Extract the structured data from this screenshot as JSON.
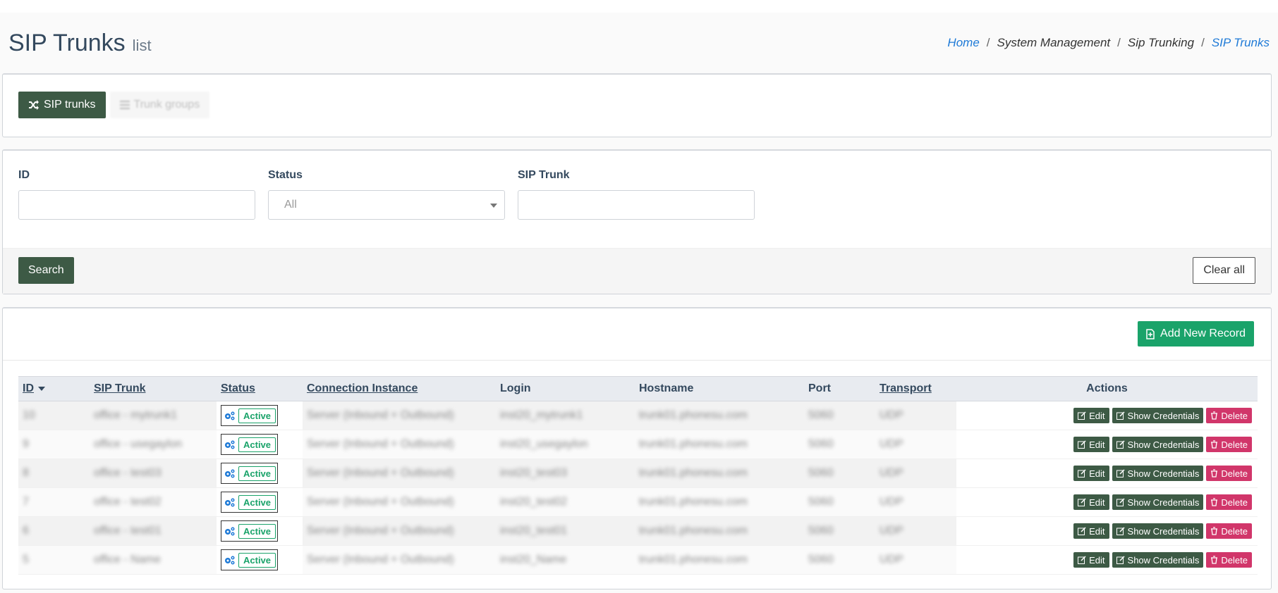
{
  "header": {
    "title": "SIP Trunks",
    "subtitle": "list",
    "breadcrumb": [
      "Home",
      "System Management",
      "Sip Trunking",
      "SIP Trunks"
    ]
  },
  "tabs": [
    {
      "label": "SIP trunks",
      "icon": "shuffle-icon",
      "active": true
    },
    {
      "label": "Trunk groups",
      "icon": "list-icon",
      "active": false
    }
  ],
  "filters": {
    "id_label": "ID",
    "status_label": "Status",
    "status_value": "All",
    "sip_trunk_label": "SIP Trunk",
    "search_label": "Search",
    "clear_label": "Clear all"
  },
  "table": {
    "add_label": "Add New Record",
    "columns": [
      "ID",
      "SIP Trunk",
      "Status",
      "Connection Instance",
      "Login",
      "Hostname",
      "Port",
      "Transport",
      "Actions"
    ],
    "rows": [
      {
        "id": "10",
        "trunk": "office - mytrunk1",
        "status": "Active",
        "conn": "Server (Inbound + Outbound)",
        "login": "inst20_mytrunk1",
        "host": "trunk01.phonesu.com",
        "port": "5060",
        "transport": "UDP"
      },
      {
        "id": "9",
        "trunk": "office - usegaylon",
        "status": "Active",
        "conn": "Server (Inbound + Outbound)",
        "login": "inst20_usegaylon",
        "host": "trunk01.phonesu.com",
        "port": "5060",
        "transport": "UDP"
      },
      {
        "id": "8",
        "trunk": "office - test03",
        "status": "Active",
        "conn": "Server (Inbound + Outbound)",
        "login": "inst20_test03",
        "host": "trunk01.phonesu.com",
        "port": "5060",
        "transport": "UDP"
      },
      {
        "id": "7",
        "trunk": "office - test02",
        "status": "Active",
        "conn": "Server (Inbound + Outbound)",
        "login": "inst20_test02",
        "host": "trunk01.phonesu.com",
        "port": "5060",
        "transport": "UDP"
      },
      {
        "id": "6",
        "trunk": "office - test01",
        "status": "Active",
        "conn": "Server (Inbound + Outbound)",
        "login": "inst20_test01",
        "host": "trunk01.phonesu.com",
        "port": "5060",
        "transport": "UDP"
      },
      {
        "id": "5",
        "trunk": "office - Name",
        "status": "Active",
        "conn": "Server (Inbound + Outbound)",
        "login": "inst20_Name",
        "host": "trunk01.phonesu.com",
        "port": "5060",
        "transport": "UDP"
      }
    ],
    "actions": {
      "edit": "Edit",
      "credentials": "Show Credentials",
      "delete": "Delete"
    }
  },
  "colors": {
    "primary": "#3d5a45",
    "success": "#1aa36a",
    "danger": "#d1366a",
    "link": "#1e7ad7"
  }
}
